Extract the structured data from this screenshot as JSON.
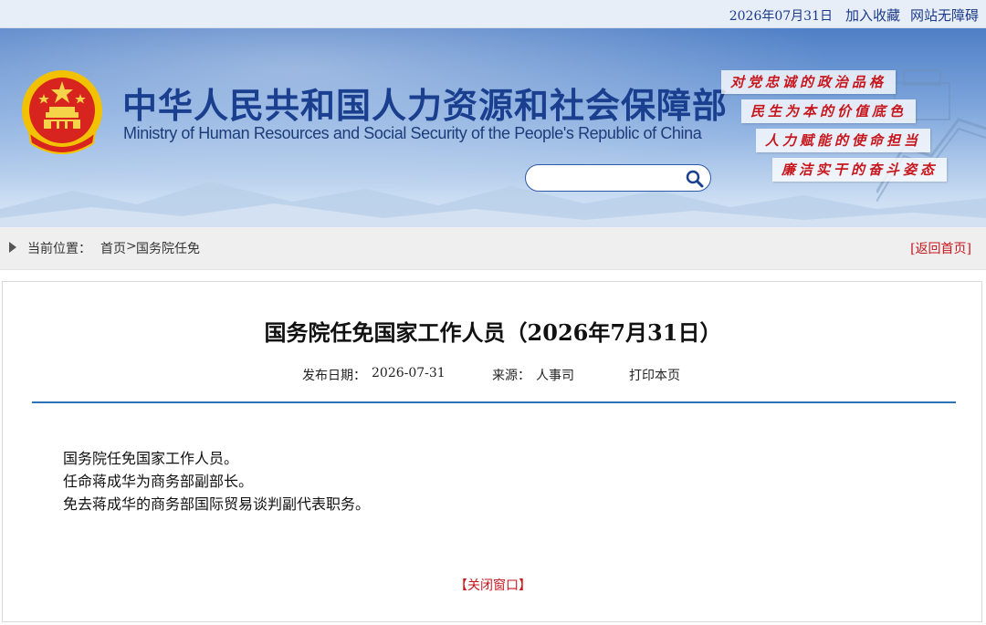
{
  "topbar": {
    "date": "2026年07月31日",
    "add_favorite": "加入收藏",
    "accessibility": "网站无障碍"
  },
  "banner": {
    "title_cn": "中华人民共和国人力资源和社会保障部",
    "title_en": "Ministry of Human Resources and Social Security of the People's Republic of China",
    "search_placeholder": "",
    "slogans": [
      "对党忠诚的政治品格",
      "民生为本的价值底色",
      "人力赋能的使命担当",
      "廉洁实干的奋斗姿态"
    ]
  },
  "breadcrumb": {
    "label": "当前位置：",
    "home": "首页",
    "separator": ">",
    "current": "国务院任免",
    "back_home": "[返回首页]"
  },
  "article": {
    "title": "国务院任免国家工作人员（2026年7月31日）",
    "publish_label": "发布日期：",
    "publish_date": "2026-07-31",
    "source_label": "来源：",
    "source": "人事司",
    "print": "打印本页",
    "paragraphs": [
      "国务院任免国家工作人员。",
      "任命蒋成华为商务部副部长。",
      "免去蒋成华的商务部国际贸易谈判副代表职务。"
    ],
    "close_window": "【关闭窗口】"
  },
  "colors": {
    "brand_blue": "#1b3f8f",
    "accent_red": "#c8161d",
    "divider_blue": "#2c72b6"
  },
  "icons": {
    "search": "search-icon",
    "emblem": "national-emblem-icon",
    "breadcrumb_marker": "triangle-right-icon"
  }
}
